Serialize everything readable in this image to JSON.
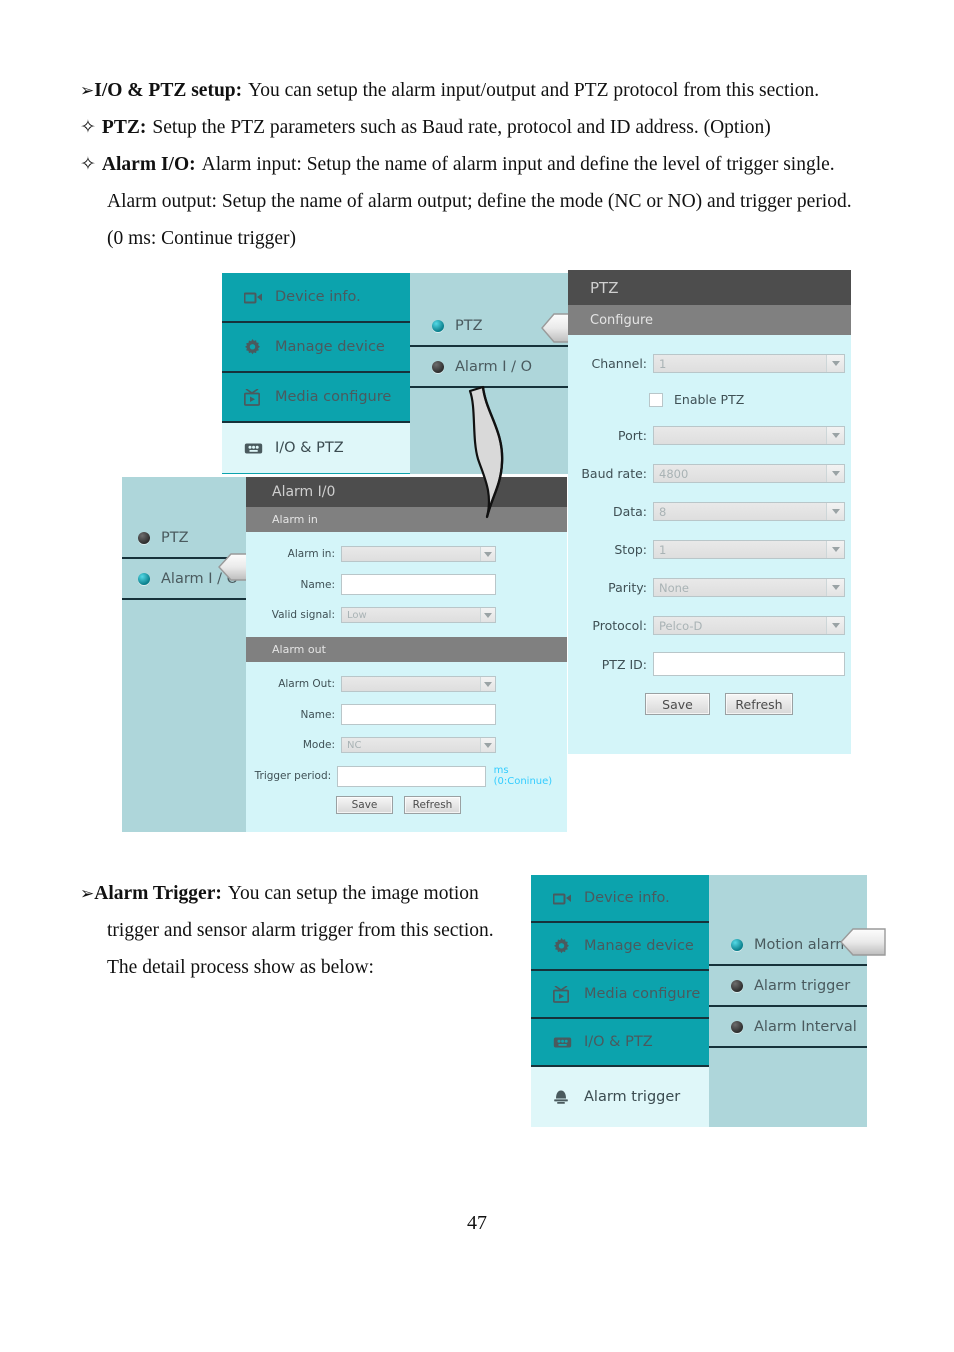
{
  "document": {
    "page_number": "47",
    "paragraphs": [
      {
        "bullet": "➢",
        "bold": "I/O & PTZ setup:",
        "text": "You can setup the alarm input/output and PTZ protocol from this section.",
        "indent": false
      },
      {
        "bullet": "✧",
        "bold": "PTZ:",
        "text": "Setup the PTZ parameters such as Baud rate, protocol and ID address. (Option)",
        "indent": false
      },
      {
        "bullet": "✧",
        "bold": "Alarm I/O:",
        "text": "Alarm input: Setup the name of alarm input and define the level of trigger single.",
        "indent": false
      },
      {
        "bullet": "",
        "bold": "",
        "text": "Alarm output: Setup the name of alarm output; define the mode (NC or NO) and trigger period.",
        "indent": true
      },
      {
        "bullet": "",
        "bold": "",
        "text": "(0 ms: Continue trigger)",
        "indent": true
      }
    ],
    "alarm_trigger_paragraph": {
      "bullet": "➢",
      "bold": "Alarm Trigger:",
      "lines": [
        "You can setup the image motion",
        "trigger and sensor alarm trigger from this section.",
        "The detail process show as below:"
      ]
    }
  },
  "colors": {
    "nav_teal": "#0ca3ad",
    "nav_active": "#dff7f9",
    "sub_panel": "#aed6da",
    "panel_bg": "#d4f5f9",
    "titlebar": "#4d4d4d",
    "subbar": "#808080",
    "hint_blue": "#33ccff"
  },
  "figure1": {
    "nav_menu": {
      "items": [
        {
          "label": "Device info.",
          "icon": "camcorder-icon",
          "active": false
        },
        {
          "label": "Manage device",
          "icon": "gear-icon",
          "active": false
        },
        {
          "label": "Media configure",
          "icon": "media-box-icon",
          "active": false
        },
        {
          "label": "I/O & PTZ",
          "icon": "io-port-icon",
          "active": true
        }
      ]
    },
    "submenu_top": {
      "items": [
        {
          "label": "PTZ",
          "selected": true
        },
        {
          "label": "Alarm I / O",
          "selected": false
        }
      ]
    },
    "submenu_bottom": {
      "items": [
        {
          "label": "PTZ",
          "selected": false
        },
        {
          "label": "Alarm I / O",
          "selected": true
        }
      ]
    },
    "ptz_panel": {
      "title": "PTZ",
      "section": "Configure",
      "fields": [
        {
          "label": "Channel:",
          "type": "select",
          "value": "1"
        },
        {
          "label": "Enable PTZ",
          "type": "checkbox",
          "checked": false
        },
        {
          "label": "Port:",
          "type": "select",
          "value": ""
        },
        {
          "label": "Baud rate:",
          "type": "select",
          "value": "4800"
        },
        {
          "label": "Data:",
          "type": "select",
          "value": "8"
        },
        {
          "label": "Stop:",
          "type": "select",
          "value": "1"
        },
        {
          "label": "Parity:",
          "type": "select",
          "value": "None"
        },
        {
          "label": "Protocol:",
          "type": "select",
          "value": "Pelco-D"
        },
        {
          "label": "PTZ ID:",
          "type": "textbox",
          "value": ""
        }
      ],
      "buttons": {
        "save": "Save",
        "refresh": "Refresh"
      }
    },
    "alarm_panel": {
      "title": "Alarm I/0",
      "section_in": "Alarm in",
      "section_out": "Alarm out",
      "fields_in": [
        {
          "label": "Alarm in:",
          "type": "select",
          "value": ""
        },
        {
          "label": "Name:",
          "type": "textbox",
          "value": ""
        },
        {
          "label": "Valid signal:",
          "type": "select",
          "value": "Low"
        }
      ],
      "fields_out": [
        {
          "label": "Alarm Out:",
          "type": "select",
          "value": ""
        },
        {
          "label": "Name:",
          "type": "textbox",
          "value": ""
        },
        {
          "label": "Mode:",
          "type": "select",
          "value": "NC"
        },
        {
          "label": "Trigger period:",
          "type": "textbox",
          "value": ""
        }
      ],
      "hint": "ms (0:Coninue)",
      "buttons": {
        "save": "Save",
        "refresh": "Refresh"
      }
    }
  },
  "figure2": {
    "nav_menu": {
      "items": [
        {
          "label": "Device info.",
          "icon": "camcorder-icon",
          "active": false
        },
        {
          "label": "Manage device",
          "icon": "gear-icon",
          "active": false
        },
        {
          "label": "Media configure",
          "icon": "media-box-icon",
          "active": false
        },
        {
          "label": "I/O & PTZ",
          "icon": "io-port-icon",
          "active": false
        },
        {
          "label": "Alarm trigger",
          "icon": "alarm-bell-icon",
          "active": true
        }
      ]
    },
    "submenu": {
      "items": [
        {
          "label": "Motion alarm",
          "selected": true
        },
        {
          "label": "Alarm trigger",
          "selected": false
        },
        {
          "label": "Alarm Interval",
          "selected": false
        }
      ]
    }
  }
}
